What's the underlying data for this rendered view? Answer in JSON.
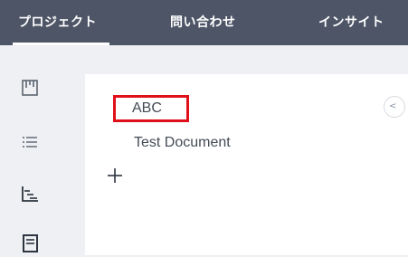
{
  "topnav": {
    "tabs": [
      {
        "label": "プロジェクト",
        "active": true
      },
      {
        "label": "問い合わせ",
        "active": false
      },
      {
        "label": "インサイト",
        "active": false
      }
    ]
  },
  "sidebar": {
    "icons": [
      "kanban-board-icon",
      "list-icon",
      "timeline-icon",
      "document-icon"
    ]
  },
  "documents": {
    "items": [
      {
        "label": "ABC",
        "highlighted": true
      },
      {
        "label": "Test Document",
        "highlighted": false
      }
    ],
    "add_icon": "plus-icon",
    "collapse_icon": "chevron-left-icon"
  },
  "colors": {
    "nav_background": "#4d5566",
    "page_background": "#eef0f3",
    "highlight_border": "#e0101a",
    "text": "#444b55"
  }
}
